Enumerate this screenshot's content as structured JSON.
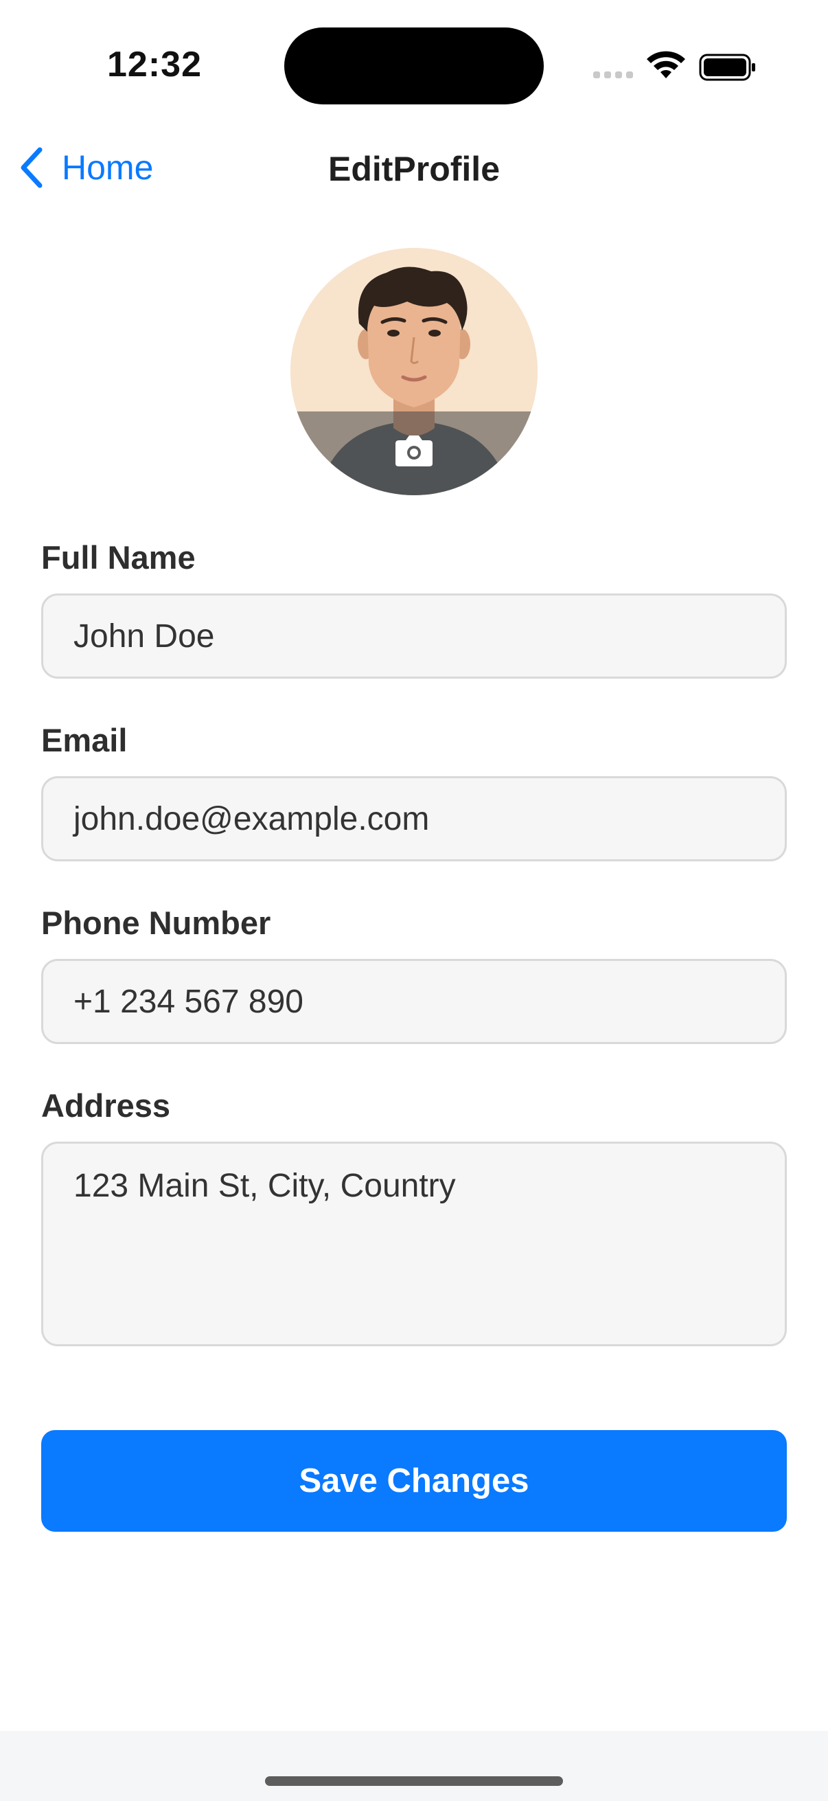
{
  "status_bar": {
    "time": "12:32",
    "signal_icon": "cellular-signal-icon",
    "wifi_icon": "wifi-icon",
    "battery_icon": "battery-icon"
  },
  "nav": {
    "back_label": "Home",
    "back_icon": "chevron-left-icon",
    "title": "EditProfile"
  },
  "avatar": {
    "overlay_icon": "camera-icon"
  },
  "form": {
    "full_name": {
      "label": "Full Name",
      "value": "John Doe"
    },
    "email": {
      "label": "Email",
      "value": "john.doe@example.com"
    },
    "phone": {
      "label": "Phone Number",
      "value": "+1 234 567 890"
    },
    "address": {
      "label": "Address",
      "value": "123 Main St, City, Country"
    }
  },
  "actions": {
    "save_label": "Save Changes"
  },
  "colors": {
    "accent": "#0a7aff",
    "field_background": "#f6f6f6",
    "field_border": "#d9d9d9"
  }
}
